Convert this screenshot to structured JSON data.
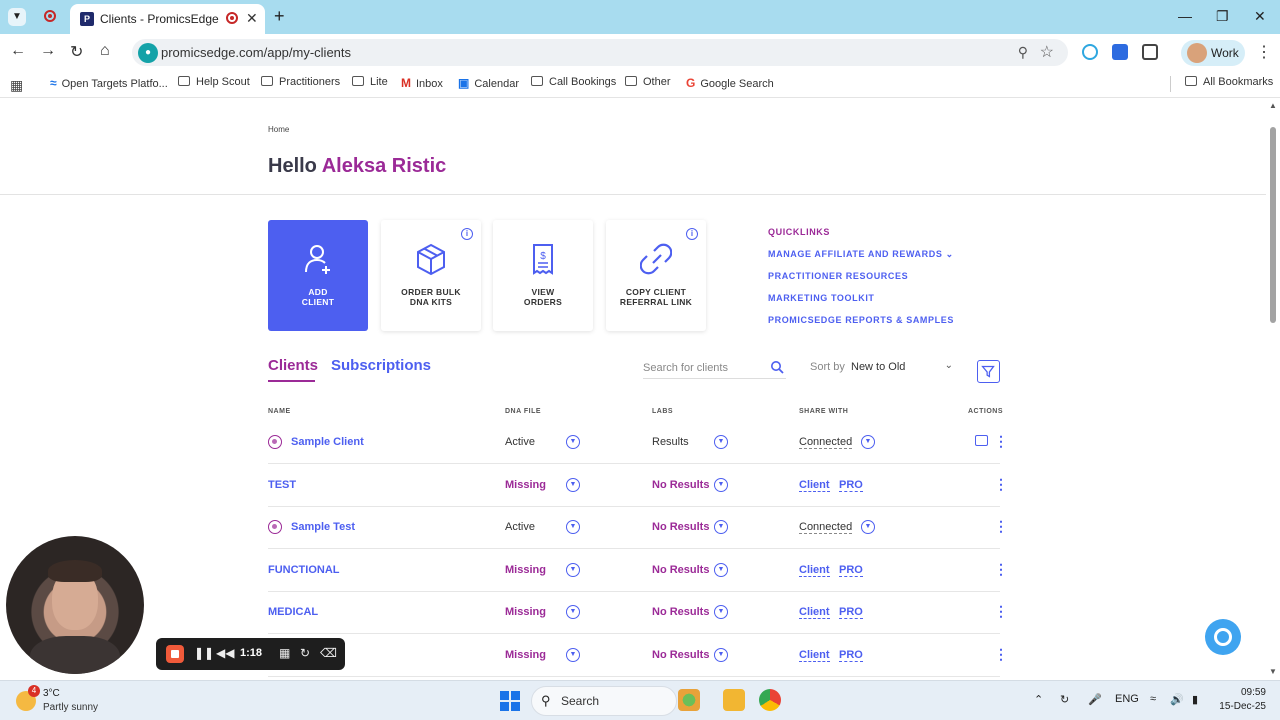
{
  "browser": {
    "tab_title": "Clients - PromicsEdge",
    "favicon_letter": "P",
    "new_tab": "+",
    "url": "promicsedge.com/app/my-clients",
    "profile_label": "Work",
    "bookmarks": [
      {
        "label": "Open Targets Platfo...",
        "icon": "pin-icon"
      },
      {
        "label": "Help Scout",
        "icon": "folder-icon"
      },
      {
        "label": "Practitioners",
        "icon": "folder-icon"
      },
      {
        "label": "Lite",
        "icon": "folder-icon"
      },
      {
        "label": "Inbox",
        "icon": "gmail-icon"
      },
      {
        "label": "Calendar",
        "icon": "calendar-icon"
      },
      {
        "label": "Call Bookings",
        "icon": "folder-icon"
      },
      {
        "label": "Other",
        "icon": "folder-icon"
      },
      {
        "label": "Google Search",
        "icon": "google-icon"
      }
    ],
    "all_bookmarks": "All Bookmarks"
  },
  "page": {
    "breadcrumb": "Home",
    "greeting_prefix": "Hello",
    "username": "Aleksa Ristic",
    "cards": [
      {
        "line1": "ADD",
        "line2": "CLIENT",
        "icon": "add-user-icon"
      },
      {
        "line1": "ORDER BULK",
        "line2": "DNA KITS",
        "icon": "box-icon"
      },
      {
        "line1": "VIEW",
        "line2": "ORDERS",
        "icon": "receipt-icon"
      },
      {
        "line1": "COPY CLIENT",
        "line2": "REFERRAL LINK",
        "icon": "link-icon"
      }
    ],
    "info_glyph": "i",
    "quicklinks": {
      "heading": "QUICKLINKS",
      "links": [
        "MANAGE AFFILIATE AND REWARDS",
        "PRACTITIONER RESOURCES",
        "MARKETING TOOLKIT",
        "PROMICSEDGE REPORTS & SAMPLES"
      ]
    },
    "tabs": [
      "Clients",
      "Subscriptions"
    ],
    "search_placeholder": "Search for clients",
    "sort_label": "Sort by",
    "sort_value": "New to Old",
    "table": {
      "headers": [
        "NAME",
        "DNA FILE",
        "LABS",
        "SHARE WITH",
        "ACTIONS"
      ],
      "rows": [
        {
          "name": "Sample Client",
          "pinned": true,
          "dna": "Active",
          "dna_style": "normal",
          "labs": "Results",
          "labs_style": "normal",
          "share": "Connected",
          "share_pro": "",
          "chat": true
        },
        {
          "name": "TEST",
          "pinned": false,
          "dna": "Missing",
          "dna_style": "purple",
          "labs": "No Results",
          "labs_style": "purple",
          "share": "Client",
          "share_pro": "PRO",
          "chat": false
        },
        {
          "name": "Sample Test",
          "pinned": true,
          "dna": "Active",
          "dna_style": "normal",
          "labs": "No Results",
          "labs_style": "purple",
          "share": "Connected",
          "share_pro": "",
          "chat": false
        },
        {
          "name": "FUNCTIONAL",
          "pinned": false,
          "dna": "Missing",
          "dna_style": "purple",
          "labs": "No Results",
          "labs_style": "purple",
          "share": "Client",
          "share_pro": "PRO",
          "chat": false
        },
        {
          "name": "MEDICAL",
          "pinned": false,
          "dna": "Missing",
          "dna_style": "purple",
          "labs": "No Results",
          "labs_style": "purple",
          "share": "Client",
          "share_pro": "PRO",
          "chat": false
        },
        {
          "name": "",
          "pinned": false,
          "dna": "Missing",
          "dna_style": "purple",
          "labs": "No Results",
          "labs_style": "purple",
          "share": "Client",
          "share_pro": "PRO",
          "chat": false
        }
      ]
    }
  },
  "recorder": {
    "time": "1:18"
  },
  "taskbar": {
    "weather_badge": "4",
    "temperature": "3°C",
    "condition": "Partly sunny",
    "search_label": "Search",
    "language": "ENG",
    "time": "09:59",
    "date": "15-Dec-25"
  },
  "colors": {
    "accent_blue": "#4d5ff0",
    "accent_purple": "#9b2a97",
    "tabbar": "#a8dcef"
  }
}
